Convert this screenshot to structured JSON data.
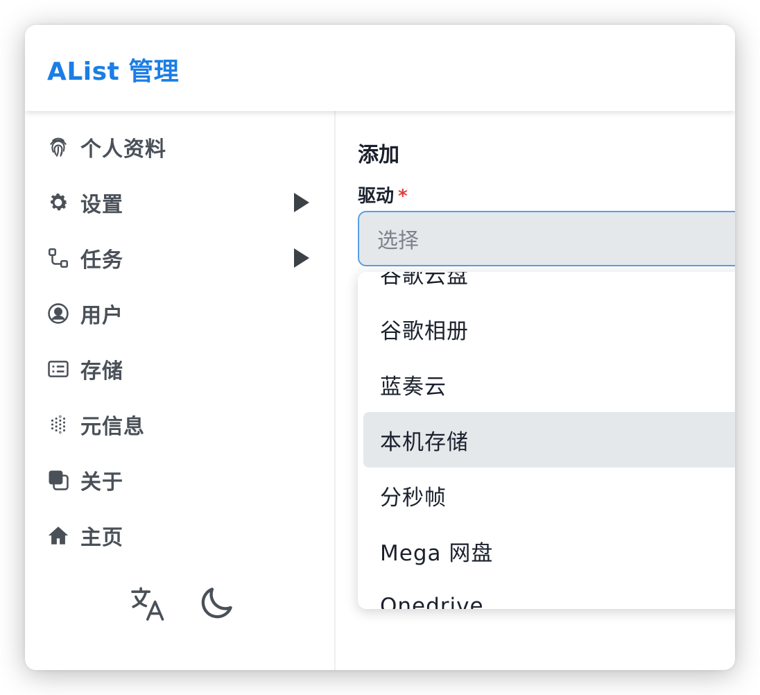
{
  "header": {
    "title": "AList 管理"
  },
  "sidebar": {
    "items": [
      {
        "label": "个人资料",
        "icon": "fingerprint-icon",
        "has_submenu": false
      },
      {
        "label": "设置",
        "icon": "gear-icon",
        "has_submenu": true
      },
      {
        "label": "任务",
        "icon": "task-flow-icon",
        "has_submenu": true
      },
      {
        "label": "用户",
        "icon": "user-circle-icon",
        "has_submenu": false
      },
      {
        "label": "存储",
        "icon": "storage-icon",
        "has_submenu": false
      },
      {
        "label": "元信息",
        "icon": "dots-grid-icon",
        "has_submenu": false
      },
      {
        "label": "关于",
        "icon": "squares-icon",
        "has_submenu": false
      },
      {
        "label": "主页",
        "icon": "home-icon",
        "has_submenu": false
      }
    ],
    "tools": [
      {
        "icon": "translate-icon"
      },
      {
        "icon": "moon-icon"
      }
    ]
  },
  "main": {
    "section_title": "添加",
    "driver_field": {
      "label": "驱动",
      "required_mark": "*",
      "placeholder": "选择"
    },
    "driver_options": [
      {
        "label": "谷歌云盘",
        "active": false
      },
      {
        "label": "谷歌相册",
        "active": false
      },
      {
        "label": "蓝奏云",
        "active": false
      },
      {
        "label": "本机存储",
        "active": true
      },
      {
        "label": "分秒帧",
        "active": false
      },
      {
        "label": "Mega 网盘",
        "active": false
      },
      {
        "label": "Onedrive",
        "active": false
      }
    ]
  },
  "colors": {
    "brand": "#1a7ee6",
    "required": "#e53e3e",
    "focus_border": "#5b9de3",
    "active_option_bg": "#e5e8eb",
    "sidebar_text": "#4a5058"
  }
}
